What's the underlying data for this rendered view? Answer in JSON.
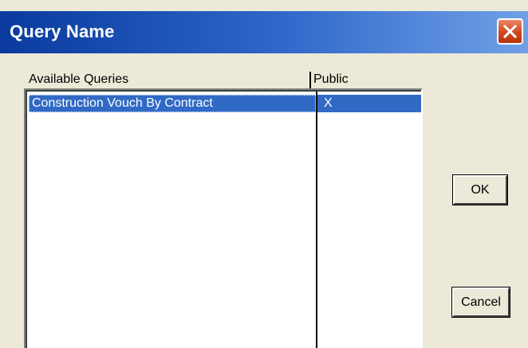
{
  "window": {
    "title": "Query Name"
  },
  "list": {
    "columns": [
      "Available Queries",
      "Public"
    ],
    "rows": [
      {
        "name": "Construction Vouch By Contract",
        "public": "X",
        "selected": true
      }
    ]
  },
  "buttons": {
    "ok_label": "OK",
    "cancel_label": "Cancel"
  },
  "colors": {
    "titlebar": "#2C64C8",
    "selection": "#316AC5",
    "dialog_background": "#ECE9D8",
    "close_button": "#D2461E"
  },
  "icons": {
    "close": "close-icon"
  }
}
